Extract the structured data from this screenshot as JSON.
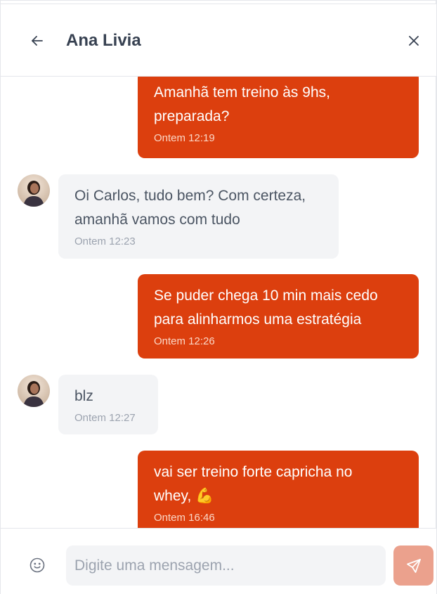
{
  "header": {
    "title": "Ana Livia",
    "back_icon": "arrow-left-icon",
    "close_icon": "close-icon"
  },
  "colors": {
    "outgoing_bubble": "#dc3f0e",
    "incoming_bubble": "#f3f4f6",
    "send_button": "#eba18d"
  },
  "messages": [
    {
      "direction": "outgoing",
      "lines": [
        "Amanhã tem treino às 9hs,",
        "preparada?"
      ],
      "time": "Ontem 12:19"
    },
    {
      "direction": "incoming",
      "lines": [
        "Oi Carlos, tudo bem? Com certeza,",
        "amanhã vamos com tudo"
      ],
      "time": "Ontem 12:23"
    },
    {
      "direction": "outgoing",
      "lines": [
        "Se puder chega 10 min mais cedo",
        "para alinharmos uma estratégia"
      ],
      "time": "Ontem 12:26"
    },
    {
      "direction": "incoming",
      "lines": [
        "blz"
      ],
      "time": "Ontem 12:27"
    },
    {
      "direction": "outgoing",
      "lines": [
        "vai ser treino forte capricha no",
        "whey, 💪"
      ],
      "time": "Ontem 16:46"
    }
  ],
  "composer": {
    "placeholder": "Digite uma mensagem...",
    "value": "",
    "emoji_icon": "smiley-icon",
    "send_icon": "send-icon"
  }
}
